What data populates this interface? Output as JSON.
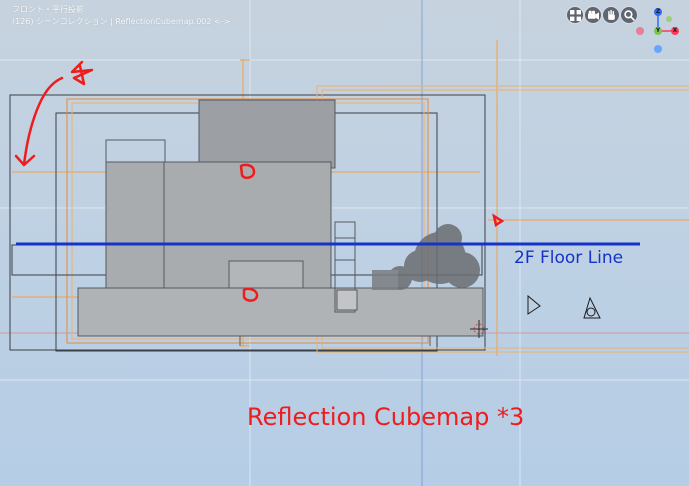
{
  "header": {
    "view_name": "フロント・平行投影",
    "scene_info": "(126) シーンコレクション | ReflectionCubemap.002 <->"
  },
  "nav_gizmo": {
    "buttons": [
      {
        "name": "grid-icon"
      },
      {
        "name": "camera-icon"
      },
      {
        "name": "hand-icon"
      },
      {
        "name": "zoom-icon"
      }
    ],
    "axes": {
      "z": "Z",
      "y": "Y",
      "x": "X"
    },
    "colors": {
      "z": "#2a6bff",
      "y": "#7ec34a",
      "x": "#ff3b5c",
      "neg_x": "#e57f9a",
      "neg_y": "#9bcf79",
      "neg_z": "#66a6ff"
    }
  },
  "annotations": {
    "floor_line_label": "2F Floor Line",
    "cubemap_label": "Reflection Cubemap *3"
  },
  "colors": {
    "viewport_bg": "#bfd1e3",
    "annotation_red": "#ee1c1c",
    "floor_line_blue": "#1633c8",
    "probe_orange": "#f0a04a",
    "grid_line": "#e4ecf4"
  }
}
